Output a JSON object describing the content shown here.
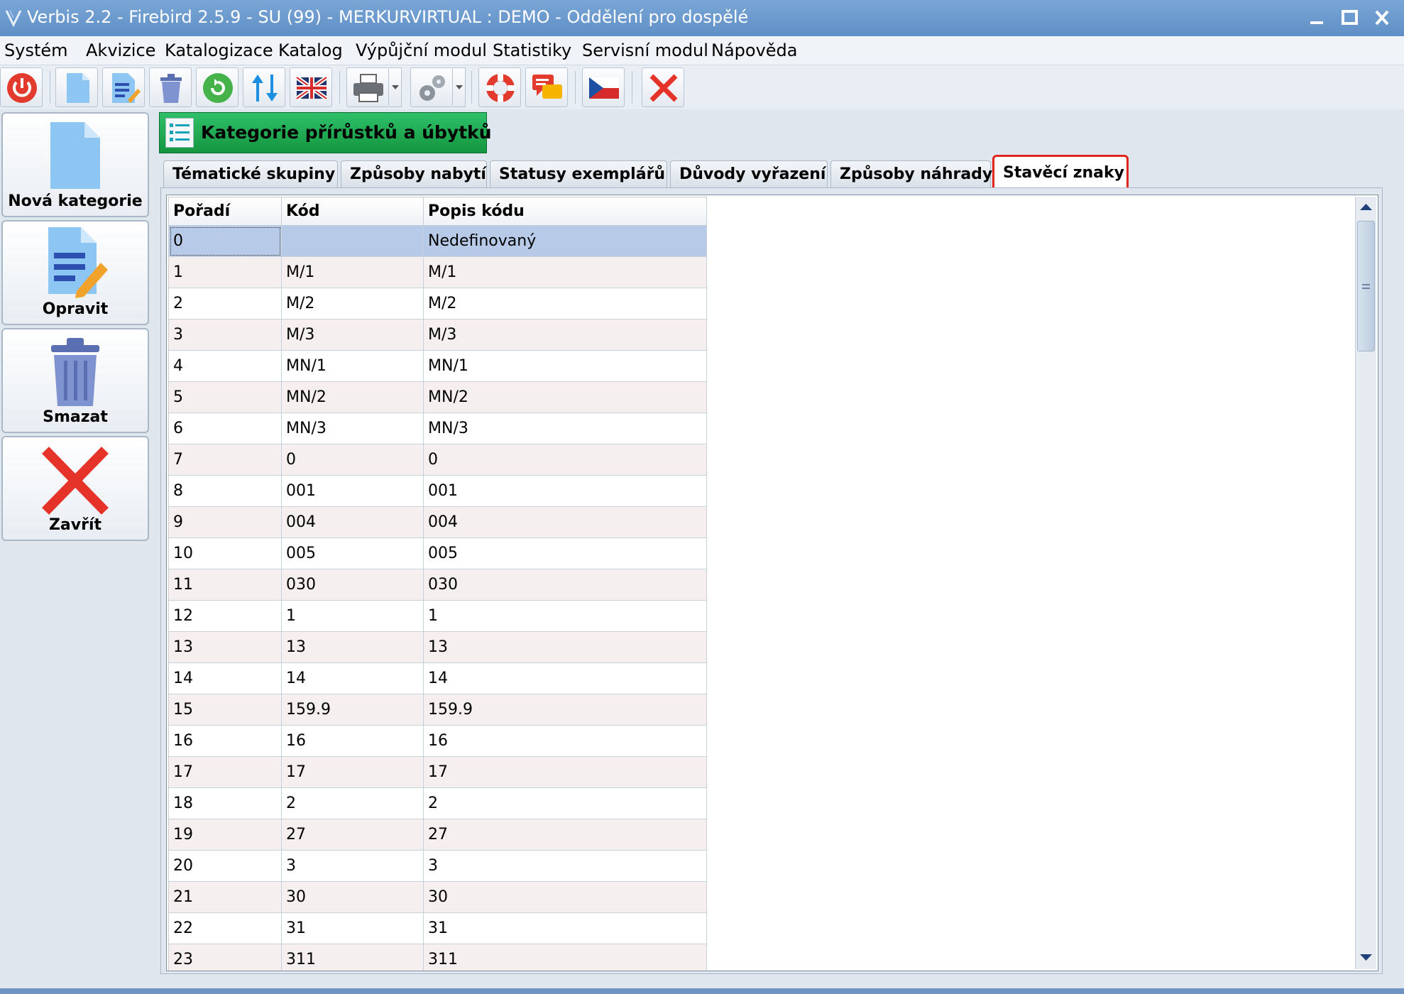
{
  "window": {
    "title": "Verbis 2.2 - Firebird 2.5.9 - SU (99) - MERKURVIRTUAL : DEMO - Oddělení pro dospělé"
  },
  "menu": [
    "Systém",
    "Akvizice",
    "Katalogizace",
    "Katalog",
    "Výpůjční modul",
    "Statistiky",
    "Servisní modul",
    "Nápověda"
  ],
  "toolbar": {
    "icons": [
      "power-icon",
      "new-document-icon",
      "edit-document-icon",
      "trash-icon",
      "refresh-icon",
      "sort-icon",
      "language-flag-uk-icon",
      "printer-icon",
      "settings-gear-icon",
      "help-lifebuoy-icon",
      "messages-icon",
      "language-flag-cz-icon",
      "close-red-x-icon"
    ]
  },
  "sidebar": {
    "new_label": "Nová kategorie",
    "edit_label": "Opravit",
    "delete_label": "Smazat",
    "close_label": "Zavřít"
  },
  "module": {
    "title": "Kategorie přírůstků a úbytků"
  },
  "tabs": [
    {
      "label": "Tématické skupiny",
      "active": false
    },
    {
      "label": "Způsoby nabytí",
      "active": false
    },
    {
      "label": "Statusy exemplářů",
      "active": false
    },
    {
      "label": "Důvody vyřazení",
      "active": false
    },
    {
      "label": "Způsoby náhrady",
      "active": false
    },
    {
      "label": "Stavěcí znaky",
      "active": true
    }
  ],
  "table": {
    "headers": [
      "Pořadí",
      "Kód",
      "Popis kódu"
    ],
    "selected_row": 0,
    "rows": [
      [
        "0",
        "",
        "Nedefinovaný"
      ],
      [
        "1",
        "M/1",
        "M/1"
      ],
      [
        "2",
        "M/2",
        "M/2"
      ],
      [
        "3",
        "M/3",
        "M/3"
      ],
      [
        "4",
        "MN/1",
        "MN/1"
      ],
      [
        "5",
        "MN/2",
        "MN/2"
      ],
      [
        "6",
        "MN/3",
        "MN/3"
      ],
      [
        "7",
        "0",
        "0"
      ],
      [
        "8",
        "001",
        "001"
      ],
      [
        "9",
        "004",
        "004"
      ],
      [
        "10",
        "005",
        "005"
      ],
      [
        "11",
        "030",
        "030"
      ],
      [
        "12",
        "1",
        "1"
      ],
      [
        "13",
        "13",
        "13"
      ],
      [
        "14",
        "14",
        "14"
      ],
      [
        "15",
        "159.9",
        "159.9"
      ],
      [
        "16",
        "16",
        "16"
      ],
      [
        "17",
        "17",
        "17"
      ],
      [
        "18",
        "2",
        "2"
      ],
      [
        "19",
        "27",
        "27"
      ],
      [
        "20",
        "3",
        "3"
      ],
      [
        "21",
        "30",
        "30"
      ],
      [
        "22",
        "31",
        "31"
      ],
      [
        "23",
        "311",
        "311"
      ]
    ]
  },
  "colors": {
    "accent_green": "#1fa84f",
    "selection_blue": "#b7cbe8",
    "highlight_red": "#e0261f",
    "title_bar": "#6b99cd"
  }
}
